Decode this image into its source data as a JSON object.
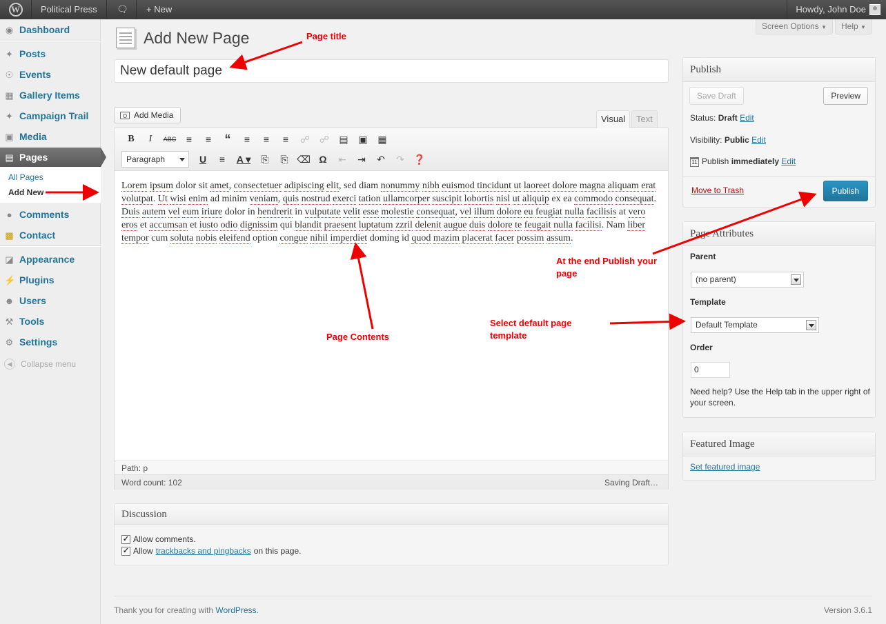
{
  "adminbar": {
    "site_name": "Political Press",
    "new_label": "New",
    "howdy": "Howdy, John Doe"
  },
  "menu": {
    "dashboard": "Dashboard",
    "posts": "Posts",
    "events": "Events",
    "gallery": "Gallery Items",
    "campaign": "Campaign Trail",
    "media": "Media",
    "pages": "Pages",
    "all_pages": "All Pages",
    "add_new": "Add New",
    "comments": "Comments",
    "contact": "Contact",
    "appearance": "Appearance",
    "plugins": "Plugins",
    "users": "Users",
    "tools": "Tools",
    "settings": "Settings",
    "collapse": "Collapse menu"
  },
  "screen_options": "Screen Options",
  "help": "Help",
  "page_heading": "Add New Page",
  "title_value": "New default page",
  "editor": {
    "add_media": "Add Media",
    "tab_visual": "Visual",
    "tab_text": "Text",
    "format_select": "Paragraph",
    "segments": [
      {
        "t": "Lorem",
        "s": true
      },
      {
        "t": " "
      },
      {
        "t": "ipsum",
        "s": true
      },
      {
        "t": " dolor sit "
      },
      {
        "t": "amet",
        "s": true
      },
      {
        "t": ", "
      },
      {
        "t": "consectetuer",
        "s": true
      },
      {
        "t": " "
      },
      {
        "t": "adipiscing",
        "s": true
      },
      {
        "t": " "
      },
      {
        "t": "elit",
        "s": true
      },
      {
        "t": ", sed diam "
      },
      {
        "t": "nonummy",
        "s": true
      },
      {
        "t": " "
      },
      {
        "t": "nibh",
        "s": true
      },
      {
        "t": " "
      },
      {
        "t": "euismod",
        "s": true
      },
      {
        "t": " "
      },
      {
        "t": "tincidunt",
        "s": true
      },
      {
        "t": " "
      },
      {
        "t": "ut",
        "s": true
      },
      {
        "t": " "
      },
      {
        "t": "laoreet",
        "s": true
      },
      {
        "t": " "
      },
      {
        "t": "dolore",
        "s": true
      },
      {
        "t": " "
      },
      {
        "t": "magna",
        "s": true
      },
      {
        "t": " "
      },
      {
        "t": "aliquam",
        "s": true
      },
      {
        "t": " "
      },
      {
        "t": "erat",
        "s": true
      },
      {
        "t": " "
      },
      {
        "t": "volutpat",
        "s": true
      },
      {
        "t": ". "
      },
      {
        "t": "Ut",
        "s": true
      },
      {
        "t": " "
      },
      {
        "t": "wisi",
        "s": true
      },
      {
        "t": " "
      },
      {
        "t": "enim",
        "s": true
      },
      {
        "t": " ad minim "
      },
      {
        "t": "veniam",
        "s": true
      },
      {
        "t": ", "
      },
      {
        "t": "quis",
        "s": true
      },
      {
        "t": " "
      },
      {
        "t": "nostrud",
        "s": true
      },
      {
        "t": " "
      },
      {
        "t": "exerci",
        "s": true
      },
      {
        "t": " "
      },
      {
        "t": "tation",
        "s": true
      },
      {
        "t": " "
      },
      {
        "t": "ullamcorper",
        "s": true
      },
      {
        "t": " "
      },
      {
        "t": "suscipit",
        "s": true
      },
      {
        "t": " "
      },
      {
        "t": "lobortis",
        "s": true
      },
      {
        "t": " "
      },
      {
        "t": "nisl",
        "s": true
      },
      {
        "t": " "
      },
      {
        "t": "ut",
        "s": true
      },
      {
        "t": " "
      },
      {
        "t": "aliquip",
        "s": true
      },
      {
        "t": " ex ea "
      },
      {
        "t": "commodo",
        "s": true
      },
      {
        "t": " "
      },
      {
        "t": "consequat",
        "s": true
      },
      {
        "t": ". "
      },
      {
        "t": "Duis",
        "s": true
      },
      {
        "t": " "
      },
      {
        "t": "autem",
        "s": true
      },
      {
        "t": " "
      },
      {
        "t": "vel",
        "s": true
      },
      {
        "t": " "
      },
      {
        "t": "eum",
        "s": true
      },
      {
        "t": " "
      },
      {
        "t": "iriure",
        "s": true
      },
      {
        "t": " dolor in "
      },
      {
        "t": "hendrerit",
        "s": true
      },
      {
        "t": " in "
      },
      {
        "t": "vulputate",
        "s": true
      },
      {
        "t": " "
      },
      {
        "t": "velit",
        "s": true
      },
      {
        "t": " "
      },
      {
        "t": "esse",
        "s": true
      },
      {
        "t": " "
      },
      {
        "t": "molestie",
        "s": true
      },
      {
        "t": " "
      },
      {
        "t": "consequat",
        "s": true
      },
      {
        "t": ", "
      },
      {
        "t": "vel",
        "s": true
      },
      {
        "t": " "
      },
      {
        "t": "illum",
        "s": true
      },
      {
        "t": " "
      },
      {
        "t": "dolore",
        "s": true
      },
      {
        "t": " "
      },
      {
        "t": "eu",
        "s": true
      },
      {
        "t": " "
      },
      {
        "t": "feugiat",
        "s": true
      },
      {
        "t": " "
      },
      {
        "t": "nulla",
        "s": true
      },
      {
        "t": " "
      },
      {
        "t": "facilisis",
        "s": true
      },
      {
        "t": " at "
      },
      {
        "t": "vero",
        "s": true
      },
      {
        "t": " "
      },
      {
        "t": "eros",
        "s": true
      },
      {
        "t": " et "
      },
      {
        "t": "accumsan",
        "s": true
      },
      {
        "t": " et "
      },
      {
        "t": "iusto",
        "s": true
      },
      {
        "t": " "
      },
      {
        "t": "odio",
        "s": true
      },
      {
        "t": " "
      },
      {
        "t": "dignissim",
        "s": true
      },
      {
        "t": " qui "
      },
      {
        "t": "blandit",
        "s": true
      },
      {
        "t": " "
      },
      {
        "t": "praesent",
        "s": true
      },
      {
        "t": " "
      },
      {
        "t": "luptatum",
        "s": true
      },
      {
        "t": " "
      },
      {
        "t": "zzril",
        "s": true
      },
      {
        "t": " "
      },
      {
        "t": "delenit",
        "s": true
      },
      {
        "t": " "
      },
      {
        "t": "augue",
        "s": true
      },
      {
        "t": " "
      },
      {
        "t": "duis",
        "s": true
      },
      {
        "t": " "
      },
      {
        "t": "dolore",
        "s": true
      },
      {
        "t": " "
      },
      {
        "t": "te",
        "s": true
      },
      {
        "t": " "
      },
      {
        "t": "feugait",
        "s": true
      },
      {
        "t": " "
      },
      {
        "t": "nulla",
        "s": true
      },
      {
        "t": " "
      },
      {
        "t": "facilisi",
        "s": true
      },
      {
        "t": ". Nam "
      },
      {
        "t": "liber",
        "s": true
      },
      {
        "t": " "
      },
      {
        "t": "tempor",
        "s": true
      },
      {
        "t": " cum "
      },
      {
        "t": "soluta",
        "s": true
      },
      {
        "t": " "
      },
      {
        "t": "nobis",
        "s": true
      },
      {
        "t": " "
      },
      {
        "t": "eleifend",
        "s": true
      },
      {
        "t": " option "
      },
      {
        "t": "congue",
        "s": true
      },
      {
        "t": " "
      },
      {
        "t": "nihil",
        "s": true
      },
      {
        "t": " "
      },
      {
        "t": "imperdiet",
        "s": true
      },
      {
        "t": " doming id "
      },
      {
        "t": "quod",
        "s": true
      },
      {
        "t": " "
      },
      {
        "t": "mazim",
        "s": true
      },
      {
        "t": " "
      },
      {
        "t": "placerat",
        "s": true
      },
      {
        "t": " "
      },
      {
        "t": "facer",
        "s": true
      },
      {
        "t": " "
      },
      {
        "t": "possim",
        "s": true
      },
      {
        "t": " "
      },
      {
        "t": "assum",
        "s": true
      },
      {
        "t": "."
      }
    ],
    "path": "Path: p",
    "word_count": "Word count: 102",
    "saving": "Saving Draft…"
  },
  "discussion": {
    "title": "Discussion",
    "allow_comments": "Allow comments.",
    "allow_prefix": "Allow",
    "trackbacks_link": "trackbacks and pingbacks",
    "allow_suffix": "on this page."
  },
  "publish": {
    "title": "Publish",
    "save_draft": "Save Draft",
    "preview": "Preview",
    "status_label": "Status:",
    "status_value": "Draft",
    "visibility_label": "Visibility:",
    "visibility_value": "Public",
    "publish_label": "Publish",
    "publish_value": "immediately",
    "edit": "Edit",
    "move_to_trash": "Move to Trash",
    "publish_button": "Publish"
  },
  "attributes": {
    "title": "Page Attributes",
    "parent_label": "Parent",
    "parent_value": "(no parent)",
    "template_label": "Template",
    "template_value": "Default Template",
    "order_label": "Order",
    "order_value": "0",
    "help_text": "Need help? Use the Help tab in the upper right of your screen."
  },
  "featured": {
    "title": "Featured Image",
    "link": "Set featured image"
  },
  "footer": {
    "thanks_prefix": "Thank you for creating with",
    "wordpress_link": "WordPress.",
    "version": "Version 3.6.1"
  },
  "annotations": {
    "page_title": "Page title",
    "page_contents": "Page Contents",
    "publish_note_1": "At the end Publish your",
    "publish_note_2": "page",
    "template_note_1": "Select default page",
    "template_note_2": "template"
  },
  "colors": {
    "accent": "#21759b",
    "annotation": "#e00000",
    "trash": "#bc0b0b"
  }
}
